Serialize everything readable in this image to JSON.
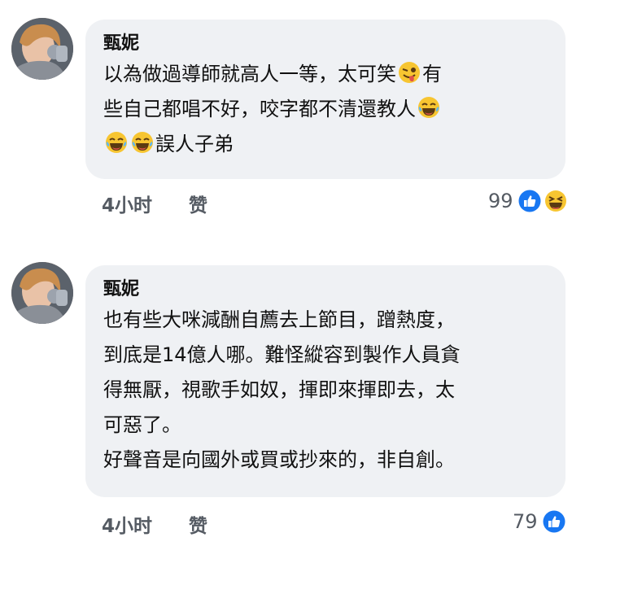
{
  "comments": [
    {
      "author": "甄妮",
      "text_line1a": "以為做過導師就高人一等，太可笑",
      "text_line1b": "有",
      "text_line2": "些自己都唱不好，咬字都不清還教人",
      "text_line3": "誤人子弟",
      "time": "4小时",
      "like_label": "赞",
      "reaction_count": "99",
      "emojis": [
        "winking-tongue-icon",
        "laughing-tears-icon",
        "laughing-tears-icon",
        "laughing-tears-icon"
      ],
      "reactions": [
        "like-icon",
        "haha-icon"
      ]
    },
    {
      "author": "甄妮",
      "text_lines": [
        "也有些大咪減酬自薦去上節目，蹭熱度，",
        "到底是14億人哪。難怪縱容到製作人員貪",
        "得無厭，視歌手如奴，揮即來揮即去，太",
        "可惡了。",
        "好聲音是向國外或買或抄來的，非自創。"
      ],
      "time": "4小时",
      "like_label": "赞",
      "reaction_count": "79",
      "reactions": [
        "like-icon"
      ]
    }
  ],
  "colors": {
    "bubble": "#eff1f4",
    "like_blue": "#1877f2",
    "emoji_yellow": "#f7c531",
    "meta_gray": "#555b63"
  }
}
